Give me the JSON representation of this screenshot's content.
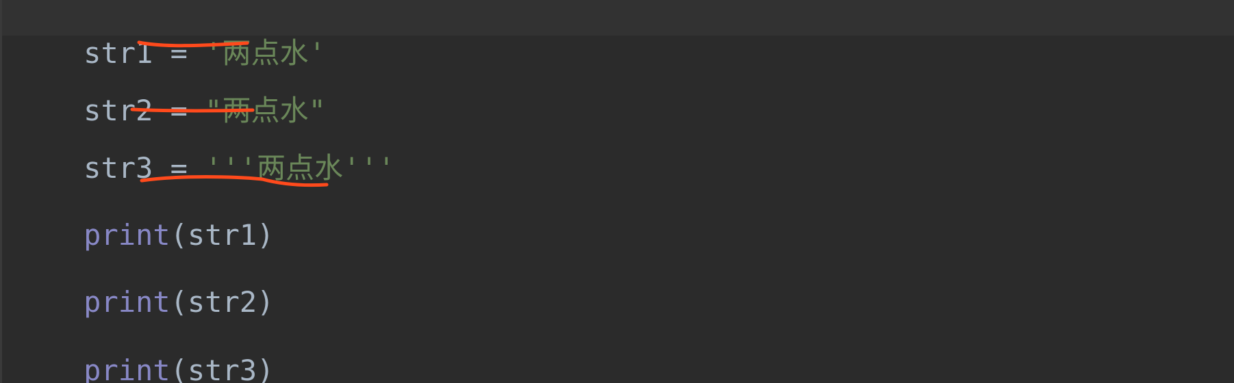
{
  "editor": {
    "lines": [
      {
        "var": "str1",
        "op": " = ",
        "str": "'两点水'"
      },
      {
        "var": "str2",
        "op": " = ",
        "str": "\"两点水\""
      },
      {
        "var": "str3",
        "op": " = ",
        "str": "'''两点水'''"
      },
      {
        "fn": "print",
        "open": "(",
        "arg": "str1",
        "close": ")"
      },
      {
        "fn": "print",
        "open": "(",
        "arg": "str2",
        "close": ")"
      },
      {
        "fn": "print",
        "open": "(",
        "arg": "str3",
        "close": ")"
      }
    ]
  },
  "colors": {
    "background": "#2b2b2b",
    "current_line": "#323232",
    "identifier": "#a9b7c6",
    "string": "#6a8759",
    "builtin": "#8888c6",
    "annotation": "#ff4a1c"
  }
}
